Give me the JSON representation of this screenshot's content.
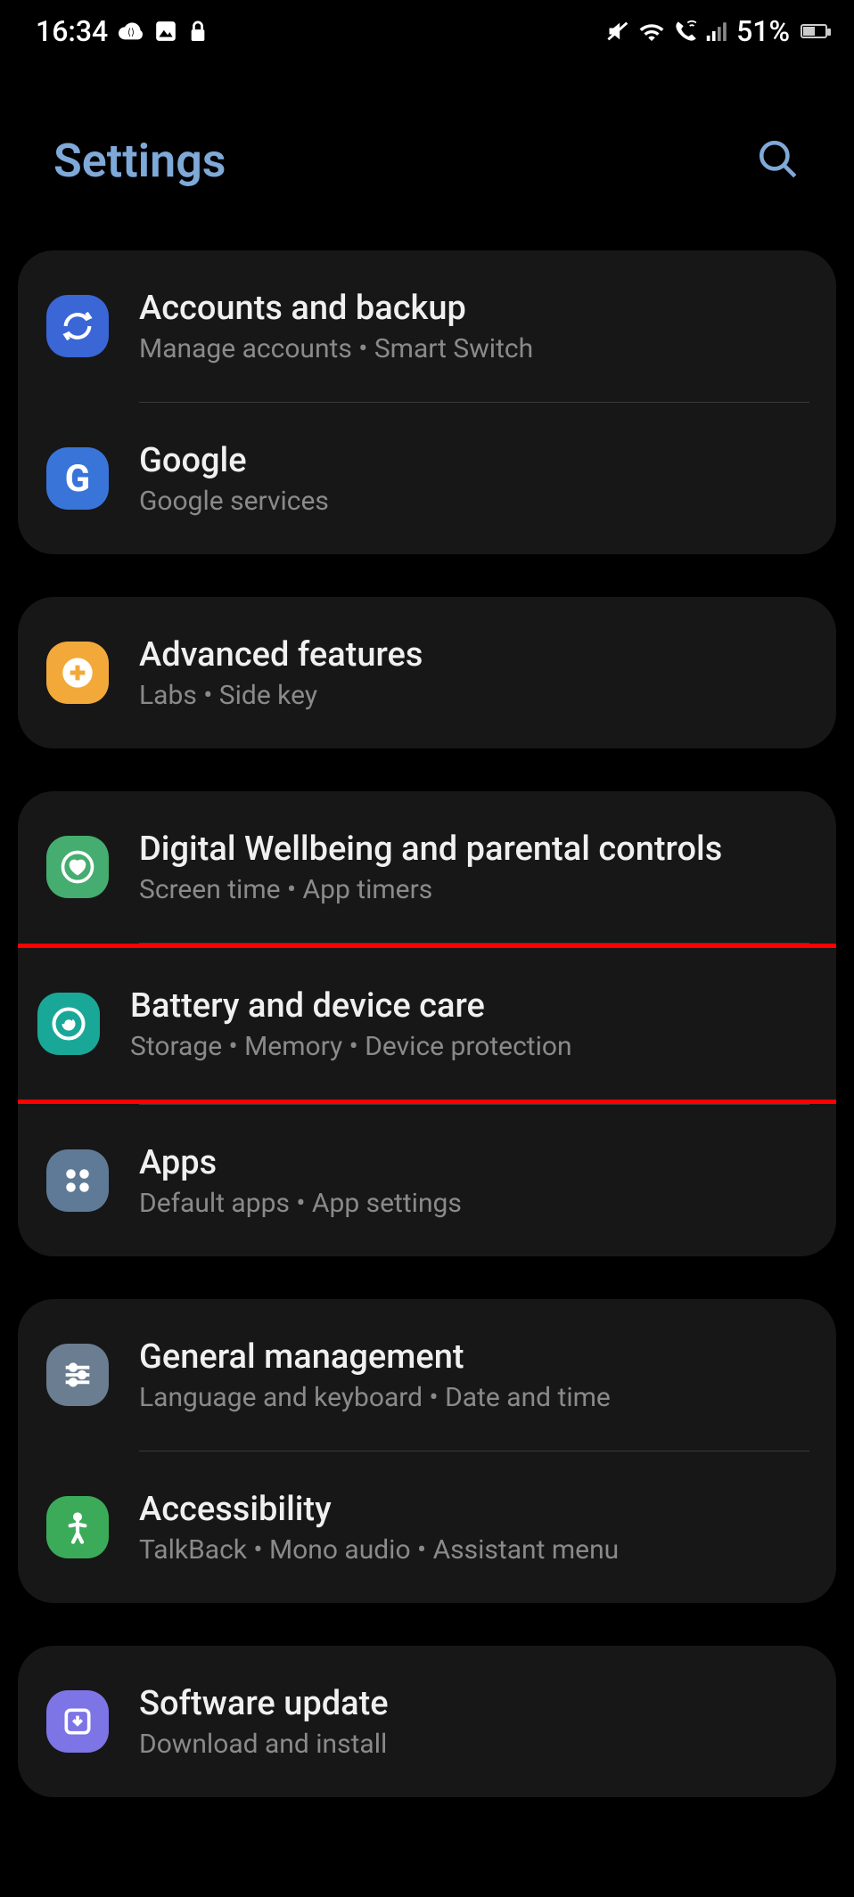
{
  "status_bar": {
    "time": "16:34",
    "battery_percent": "51%"
  },
  "header": {
    "title": "Settings"
  },
  "groups": [
    {
      "rows": [
        {
          "id": "accounts",
          "title": "Accounts and backup",
          "sub": "Manage accounts  •  Smart Switch",
          "icon": "sync-icon",
          "bg": "bg-blue"
        },
        {
          "id": "google",
          "title": "Google",
          "sub": "Google services",
          "icon": "google-icon",
          "bg": "bg-blue2"
        }
      ]
    },
    {
      "rows": [
        {
          "id": "advanced",
          "title": "Advanced features",
          "sub": "Labs  •  Side key",
          "icon": "plus-icon",
          "bg": "bg-orange"
        }
      ]
    },
    {
      "rows": [
        {
          "id": "wellbeing",
          "title": "Digital Wellbeing and parental controls",
          "sub": "Screen time  •  App timers",
          "icon": "heart-circle-icon",
          "bg": "bg-green"
        },
        {
          "id": "battery",
          "title": "Battery and device care",
          "sub": "Storage  •  Memory  •  Device protection",
          "icon": "care-icon",
          "bg": "bg-teal",
          "highlight": true
        },
        {
          "id": "apps",
          "title": "Apps",
          "sub": "Default apps  •  App settings",
          "icon": "apps-icon",
          "bg": "bg-bluegray"
        }
      ]
    },
    {
      "rows": [
        {
          "id": "general",
          "title": "General management",
          "sub": "Language and keyboard  •  Date and time",
          "icon": "sliders-icon",
          "bg": "bg-slate"
        },
        {
          "id": "accessibility",
          "title": "Accessibility",
          "sub": "TalkBack  •  Mono audio  •  Assistant menu",
          "icon": "person-icon",
          "bg": "bg-green2"
        }
      ]
    },
    {
      "rows": [
        {
          "id": "software",
          "title": "Software update",
          "sub": "Download and install",
          "icon": "download-icon",
          "bg": "bg-violet"
        }
      ]
    }
  ]
}
